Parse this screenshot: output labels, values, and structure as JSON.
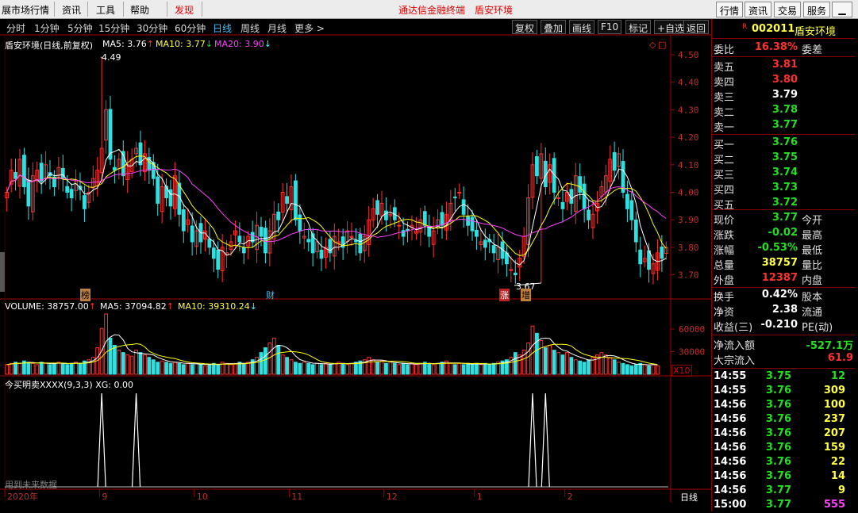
{
  "menu": {
    "items": [
      "展市场行情",
      "资讯",
      "工具",
      "帮助",
      "发现"
    ],
    "center_title": "通达信金融终端",
    "center_stock": "盾安环境",
    "right_buttons": [
      "行情",
      "资讯",
      "交易",
      "服务"
    ]
  },
  "toolbar": {
    "periods": [
      "分时",
      "1分钟",
      "5分钟",
      "15分钟",
      "30分钟",
      "60分钟",
      "日线",
      "周线",
      "月线",
      "更多 >"
    ],
    "active_period": "日线",
    "buttons": [
      "复权",
      "叠加",
      "画线",
      "F10",
      "标记",
      "+自选",
      "返回"
    ]
  },
  "legend": {
    "title": "盾安环境(日线,前复权)",
    "ma5": "MA5: 3.76",
    "ma10": "MA10: 3.77",
    "ma20": "MA20: 3.90",
    "volume": "VOLUME: 38757.00",
    "vma5": "MA5: 37094.82",
    "vma10": "MA10: 39310.24",
    "indicator": "今买明卖XXXX(9,3,3) XG: 0.00",
    "future_note": "用到未来数据",
    "high_mark": "4.49",
    "low_mark": "3.67",
    "events": [
      "榜",
      "财",
      "涨",
      "增"
    ],
    "x10_label": "X10",
    "period_tag": "日线"
  },
  "colors": {
    "up": "#ff3030",
    "down": "#30e0e0",
    "ma5": "#ffffff",
    "ma10": "#ffff00",
    "ma20": "#ff40ff",
    "axis": "#a00000"
  },
  "chart_data": {
    "type": "candlestick",
    "price_axis": {
      "ticks": [
        "4.50",
        "4.40",
        "4.30",
        "4.20",
        "4.10",
        "4.00",
        "3.90",
        "3.80",
        "3.70"
      ],
      "range": [
        3.65,
        4.52
      ]
    },
    "volume_axis": {
      "ticks": [
        "60000",
        "30000"
      ]
    },
    "x_ticks": [
      "2020年",
      "9",
      "10",
      "11",
      "12",
      "1",
      "2"
    ],
    "ma_last": {
      "ma5": 3.76,
      "ma10": 3.77,
      "ma20": 3.9
    },
    "volume_last": 38757.0,
    "signal_days": [
      22,
      30,
      122,
      125
    ],
    "closes": [
      4.0,
      4.08,
      4.05,
      4.12,
      4.02,
      3.95,
      4.06,
      4.08,
      4.04,
      4.1,
      4.06,
      4.02,
      4.09,
      4.05,
      4.0,
      3.98,
      4.04,
      4.01,
      3.94,
      4.0,
      4.05,
      4.08,
      4.16,
      4.3,
      4.12,
      4.08,
      4.12,
      4.06,
      4.1,
      4.12,
      4.16,
      4.1,
      4.14,
      4.08,
      4.05,
      3.96,
      4.02,
      3.98,
      3.95,
      4.06,
      3.92,
      3.86,
      3.9,
      3.82,
      3.86,
      3.82,
      3.86,
      3.8,
      3.76,
      3.72,
      3.8,
      3.78,
      3.82,
      3.86,
      3.82,
      3.78,
      3.84,
      3.82,
      3.88,
      3.84,
      3.78,
      3.86,
      3.92,
      3.9,
      4.0,
      3.96,
      4.02,
      3.9,
      3.86,
      3.84,
      3.82,
      3.78,
      3.82,
      3.76,
      3.8,
      3.78,
      3.84,
      3.82,
      3.8,
      3.86,
      3.84,
      3.82,
      3.78,
      3.84,
      3.9,
      3.94,
      3.92,
      3.96,
      3.9,
      3.92,
      3.9,
      3.88,
      3.84,
      3.86,
      3.88,
      3.86,
      3.9,
      3.88,
      3.84,
      3.86,
      3.9,
      3.88,
      3.92,
      3.96,
      3.98,
      4.0,
      3.92,
      3.88,
      3.86,
      3.84,
      3.82,
      3.8,
      3.82,
      3.78,
      3.8,
      3.76,
      3.74,
      3.72,
      3.7,
      3.76,
      3.84,
      3.98,
      4.1,
      4.06,
      4.14,
      4.02,
      4.1,
      4.0,
      3.98,
      3.94,
      4.0,
      3.96,
      4.06,
      4.0,
      3.94,
      3.9,
      3.92,
      3.96,
      4.02,
      4.06,
      4.12,
      4.08,
      4.14,
      4.0,
      3.94,
      3.9,
      3.82,
      3.74,
      3.76,
      3.72,
      3.74,
      3.78,
      3.76,
      3.8
    ],
    "volumes": [
      8,
      9,
      10,
      9,
      11,
      10,
      9,
      8,
      10,
      9,
      8,
      9,
      10,
      9,
      8,
      9,
      10,
      9,
      11,
      12,
      14,
      22,
      38,
      50,
      30,
      24,
      20,
      18,
      16,
      15,
      20,
      18,
      16,
      14,
      12,
      10,
      11,
      10,
      9,
      10,
      9,
      8,
      9,
      8,
      9,
      8,
      7,
      8,
      9,
      8,
      10,
      9,
      8,
      9,
      10,
      9,
      10,
      12,
      14,
      18,
      22,
      26,
      30,
      24,
      16,
      14,
      12,
      10,
      9,
      10,
      9,
      8,
      9,
      8,
      9,
      8,
      9,
      10,
      9,
      8,
      9,
      10,
      11,
      12,
      14,
      12,
      10,
      11,
      9,
      10,
      9,
      8,
      9,
      8,
      9,
      8,
      9,
      10,
      9,
      8,
      9,
      10,
      11,
      9,
      8,
      9,
      8,
      9,
      8,
      9,
      8,
      9,
      8,
      9,
      10,
      11,
      12,
      14,
      18,
      16,
      20,
      26,
      40,
      34,
      28,
      22,
      24,
      20,
      18,
      16,
      18,
      14,
      12,
      11,
      10,
      12,
      14,
      16,
      18,
      16,
      14,
      12,
      10,
      9,
      8,
      7,
      8,
      9,
      8,
      7,
      8,
      7
    ]
  },
  "quote": {
    "code": "002011",
    "name": "盾安环境",
    "r_badge": "R",
    "weibi_label": "委比",
    "weibi": "16.38%",
    "weicha_label": "委差",
    "asks": [
      {
        "l": "卖五",
        "p": "3.81"
      },
      {
        "l": "卖四",
        "p": "3.80"
      },
      {
        "l": "卖三",
        "p": "3.79"
      },
      {
        "l": "卖二",
        "p": "3.78"
      },
      {
        "l": "卖一",
        "p": "3.77"
      }
    ],
    "bids": [
      {
        "l": "买一",
        "p": "3.76"
      },
      {
        "l": "买二",
        "p": "3.75"
      },
      {
        "l": "买三",
        "p": "3.74"
      },
      {
        "l": "买四",
        "p": "3.73"
      },
      {
        "l": "买五",
        "p": "3.72"
      }
    ],
    "stats": [
      {
        "l": "现价",
        "v": "3.77",
        "c": "dn",
        "l2": "今开"
      },
      {
        "l": "涨跌",
        "v": "-0.02",
        "c": "dn",
        "l2": "最高"
      },
      {
        "l": "涨幅",
        "v": "-0.53%",
        "c": "dn",
        "l2": "最低"
      },
      {
        "l": "总量",
        "v": "38757",
        "c": "yl",
        "l2": "量比"
      },
      {
        "l": "外盘",
        "v": "12387",
        "c": "up",
        "l2": "内盘"
      }
    ],
    "stats2": [
      {
        "l": "换手",
        "v": "0.42%",
        "c": "wt",
        "l2": "股本"
      },
      {
        "l": "净资",
        "v": "2.38",
        "c": "wt",
        "l2": "流通"
      },
      {
        "l": "收益(三)",
        "v": "-0.210",
        "c": "wt",
        "l2": "PE(动)"
      }
    ],
    "flow": [
      {
        "l": "净流入额",
        "v": "-527.1万",
        "c": "dn"
      },
      {
        "l": "大宗流入",
        "v": "61.9",
        "c": "up"
      }
    ],
    "ticks": [
      {
        "t": "14:55",
        "p": "3.75",
        "v": "12",
        "c": "dn"
      },
      {
        "t": "14:55",
        "p": "3.76",
        "v": "309",
        "c": "yl"
      },
      {
        "t": "14:56",
        "p": "3.76",
        "v": "100",
        "c": "yl"
      },
      {
        "t": "14:56",
        "p": "3.76",
        "v": "237",
        "c": "yl"
      },
      {
        "t": "14:56",
        "p": "3.76",
        "v": "207",
        "c": "yl"
      },
      {
        "t": "14:56",
        "p": "3.76",
        "v": "159",
        "c": "yl"
      },
      {
        "t": "14:56",
        "p": "3.76",
        "v": "22",
        "c": "yl"
      },
      {
        "t": "14:56",
        "p": "3.76",
        "v": "14",
        "c": "yl"
      },
      {
        "t": "14:56",
        "p": "3.77",
        "v": "9",
        "c": "yl"
      },
      {
        "t": "15:00",
        "p": "3.77",
        "v": "555",
        "c": "mg"
      }
    ]
  }
}
